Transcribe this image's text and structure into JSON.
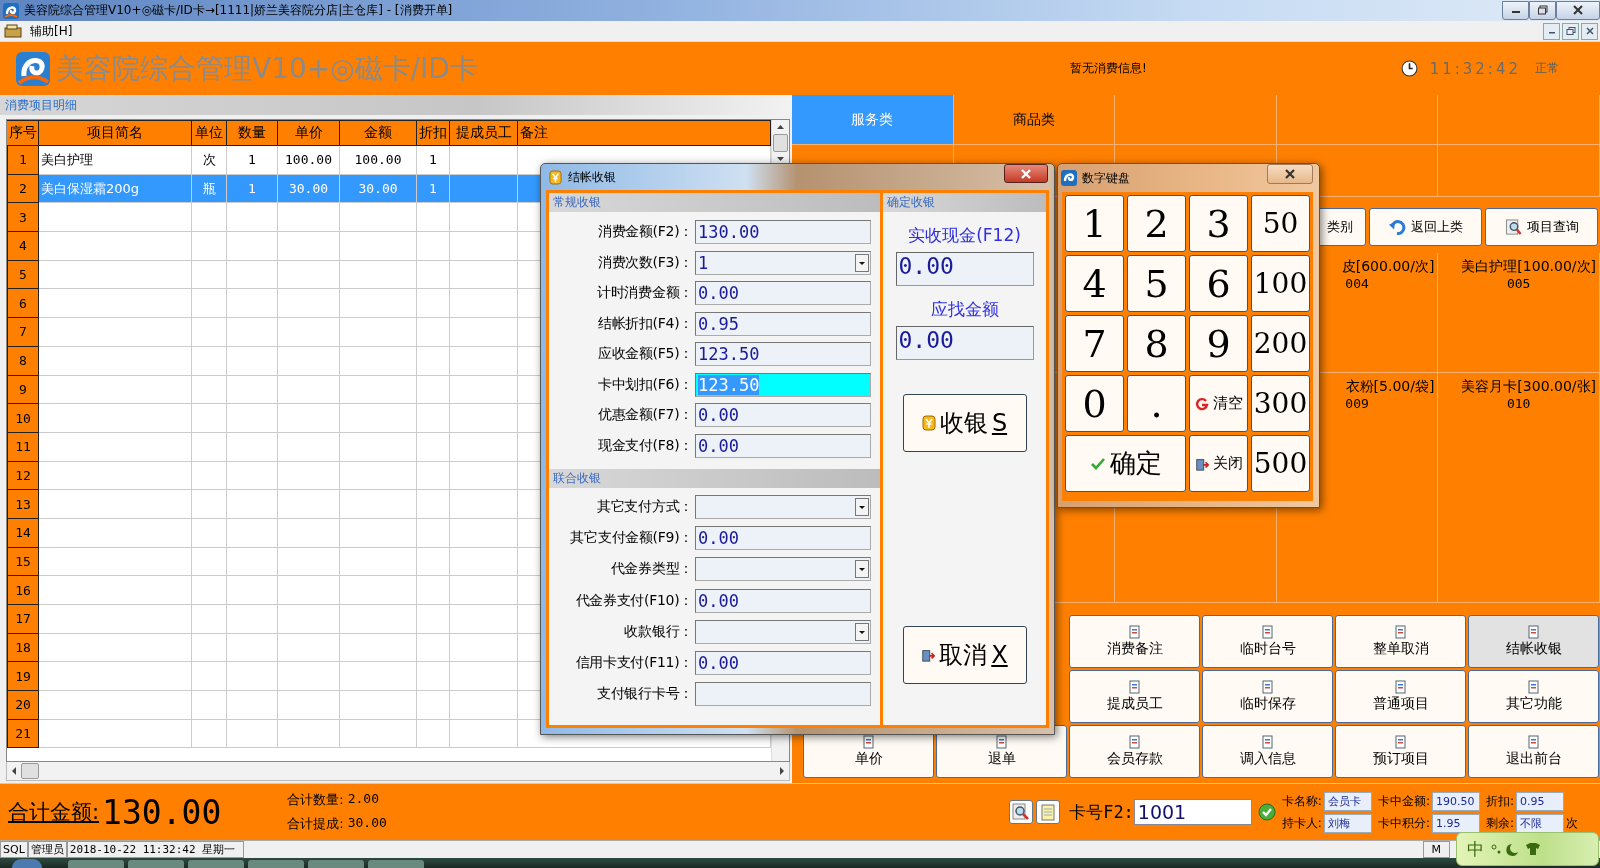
{
  "window": {
    "title": "美容院综合管理V10+◎磁卡/ID卡→[1111|娇兰美容院分店|主仓库] - [消费开单]"
  },
  "menu": [
    {
      "label": "辅助[H]"
    }
  ],
  "header": {
    "app_title": "美容院综合管理V10+◎磁卡/ID卡",
    "message": "暂无消费信息!",
    "time": "11:32:42",
    "status": "正常"
  },
  "detail": {
    "title": "消费项目明细",
    "columns": [
      "序号",
      "项目简名",
      "单位",
      "数量",
      "单价",
      "金额",
      "折扣",
      "提成员工",
      "备注"
    ],
    "rows": [
      {
        "no": "1",
        "name": "美白护理",
        "unit": "次",
        "qty": "1",
        "price": "100.00",
        "amount": "100.00",
        "discount": "1",
        "selected": false
      },
      {
        "no": "2",
        "name": "美白保湿霜200g",
        "unit": "瓶",
        "qty": "1",
        "price": "30.00",
        "amount": "30.00",
        "discount": "1",
        "selected": true
      },
      {
        "no": "3",
        "selected": false
      },
      {
        "no": "4",
        "selected": false
      },
      {
        "no": "5",
        "selected": false
      },
      {
        "no": "6",
        "selected": false
      },
      {
        "no": "7",
        "selected": false
      },
      {
        "no": "8",
        "selected": false
      },
      {
        "no": "9",
        "selected": false
      },
      {
        "no": "10",
        "selected": false
      },
      {
        "no": "11",
        "selected": false
      },
      {
        "no": "12",
        "selected": false
      },
      {
        "no": "13",
        "selected": false
      },
      {
        "no": "14",
        "selected": false
      },
      {
        "no": "15",
        "selected": false
      },
      {
        "no": "16",
        "selected": false
      },
      {
        "no": "17",
        "selected": false
      },
      {
        "no": "18",
        "selected": false
      },
      {
        "no": "19",
        "selected": false
      },
      {
        "no": "20",
        "selected": false
      },
      {
        "no": "21",
        "selected": false
      }
    ]
  },
  "categories": [
    {
      "label": "服务类",
      "selected": true
    },
    {
      "label": "商品类",
      "selected": false
    }
  ],
  "tool_buttons": [
    {
      "label": "类别"
    },
    {
      "label": "返回上类"
    },
    {
      "label": "项目查询"
    }
  ],
  "item_rows": [
    [
      {
        "name": "皮[600.00/次]",
        "code": "004"
      },
      {
        "name": "美白护理[100.00/次]",
        "code": "005"
      }
    ],
    [
      {
        "name": "衣粉[5.00/袋]",
        "code": "009"
      },
      {
        "name": "美容月卡[300.00/张]",
        "code": "010"
      }
    ]
  ],
  "actions": [
    [
      {
        "label": "消费备注",
        "active": false
      },
      {
        "label": "临时台号",
        "active": false
      },
      {
        "label": "整单取消",
        "active": false
      },
      {
        "label": "结帐收银",
        "active": true
      }
    ],
    [
      {
        "label": "提成员工",
        "active": false
      },
      {
        "label": "临时保存",
        "active": false
      },
      {
        "label": "普通项目",
        "active": false
      },
      {
        "label": "其它功能",
        "active": false
      }
    ],
    [
      {
        "label": "单价",
        "active": false
      },
      {
        "label": "退单",
        "active": false
      },
      {
        "label": "会员存款",
        "active": false
      },
      {
        "label": "调入信息",
        "active": false
      },
      {
        "label": "预订项目",
        "active": false
      },
      {
        "label": "退出前台",
        "active": false
      }
    ]
  ],
  "totals": {
    "amount_label": "合计金额:",
    "amount": "130.00",
    "quantity_label": "合计数量:",
    "quantity": "2.00",
    "commission_label": "合计提成:",
    "commission": "30.00"
  },
  "card": {
    "number_label": "卡号F2:",
    "number": "1001",
    "fields": [
      {
        "label": "卡名称:",
        "value": "会员卡"
      },
      {
        "label": "卡中金额:",
        "value": "190.50"
      },
      {
        "label": "折扣:",
        "value": "0.95"
      },
      {
        "label": "持卡人:",
        "value": "刘梅"
      },
      {
        "label": "卡中积分:",
        "value": "1.95"
      },
      {
        "label": "剩余:",
        "value": "不限",
        "unit": "次"
      }
    ]
  },
  "status_bar": [
    "SQL",
    "管理员",
    "2018-10-22 11:32:42 星期一",
    "M"
  ],
  "ime": {
    "label": "中"
  },
  "checkout": {
    "title": "结帐收银",
    "regular": {
      "title": "常规收银",
      "fields": [
        {
          "label": "消费金额(F2)：",
          "value": "130.00",
          "kind": "text",
          "highlighted": false
        },
        {
          "label": "消费次数(F3)：",
          "value": "1",
          "kind": "select",
          "highlighted": false
        },
        {
          "label": "计时消费金额：",
          "value": "0.00",
          "kind": "text",
          "highlighted": false
        },
        {
          "label": "结帐折扣(F4)：",
          "value": "0.95",
          "kind": "text",
          "highlighted": false
        },
        {
          "label": "应收金额(F5)：",
          "value": "123.50",
          "kind": "text",
          "highlighted": false
        },
        {
          "label": "卡中划扣(F6)：",
          "value": "123.50",
          "kind": "text",
          "highlighted": true
        },
        {
          "label": "优惠金额(F7)：",
          "value": "0.00",
          "kind": "text",
          "highlighted": false
        },
        {
          "label": "现金支付(F8)：",
          "value": "0.00",
          "kind": "text",
          "highlighted": false
        }
      ]
    },
    "combined": {
      "title": "联合收银",
      "fields": [
        {
          "label": "其它支付方式：",
          "kind": "select",
          "highlighted": false
        },
        {
          "label": "其它支付金额(F9)：",
          "value": "0.00",
          "kind": "text",
          "highlighted": false
        },
        {
          "label": "代金券类型：",
          "kind": "select",
          "highlighted": false
        },
        {
          "label": "代金券支付(F10)：",
          "value": "0.00",
          "kind": "text",
          "highlighted": false
        },
        {
          "label": "收款银行：",
          "kind": "select",
          "highlighted": false
        },
        {
          "label": "信用卡支付(F11)：",
          "value": "0.00",
          "kind": "text",
          "highlighted": false
        },
        {
          "label": "支付银行卡号：",
          "kind": "text",
          "highlighted": false
        }
      ]
    },
    "confirm": {
      "title": "确定收银",
      "cash_label": "实收现金(F12)",
      "cash": "0.00",
      "change_label": "应找金额",
      "change": "0.00",
      "buttons": [
        {
          "label": "收银",
          "key": "S",
          "kind": "pay"
        },
        {
          "label": "取消",
          "key": "X",
          "kind": "cancel"
        }
      ]
    }
  },
  "keypad": {
    "title": "数字键盘",
    "keys": [
      {
        "label": "1",
        "kind": "digit"
      },
      {
        "label": "2",
        "kind": "digit"
      },
      {
        "label": "3",
        "kind": "digit"
      },
      {
        "label": "50",
        "kind": "amount"
      },
      {
        "label": "4",
        "kind": "digit"
      },
      {
        "label": "5",
        "kind": "digit"
      },
      {
        "label": "6",
        "kind": "digit"
      },
      {
        "label": "100",
        "kind": "amount"
      },
      {
        "label": "7",
        "kind": "digit"
      },
      {
        "label": "8",
        "kind": "digit"
      },
      {
        "label": "9",
        "kind": "digit"
      },
      {
        "label": "200",
        "kind": "amount"
      },
      {
        "label": "0",
        "kind": "digit"
      },
      {
        "label": ".",
        "kind": "digit"
      },
      {
        "label": "清空",
        "kind": "clear"
      },
      {
        "label": "300",
        "kind": "amount"
      },
      {
        "label": "确定",
        "kind": "ok"
      },
      {
        "label": "关闭",
        "kind": "close"
      },
      {
        "label": "500",
        "kind": "amount"
      }
    ]
  }
}
